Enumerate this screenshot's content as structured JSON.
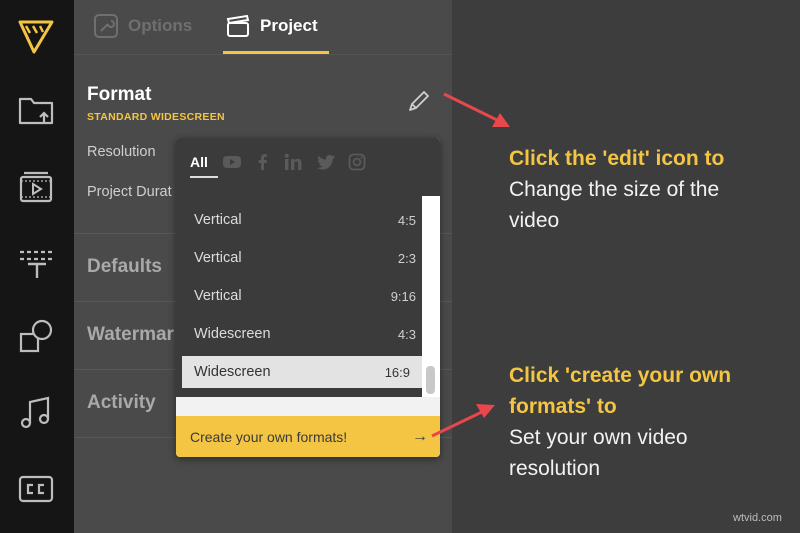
{
  "tabs": [
    {
      "label": "Options",
      "icon": "wrench-icon"
    },
    {
      "label": "Project",
      "icon": "clapperboard-icon"
    }
  ],
  "format": {
    "title": "Format",
    "subtitle": "STANDARD WIDESCREEN",
    "resolution_label": "Resolution",
    "duration_label": "Project Durat"
  },
  "sections": [
    "Defaults",
    "Watermar",
    "Activity"
  ],
  "popup": {
    "tabs": [
      "All",
      "youtube-icon",
      "facebook-icon",
      "linkedin-icon",
      "twitter-icon",
      "instagram-icon"
    ],
    "options": [
      {
        "name": "Vertical",
        "ratio": "4:5"
      },
      {
        "name": "Vertical",
        "ratio": "2:3"
      },
      {
        "name": "Vertical",
        "ratio": "9:16"
      },
      {
        "name": "Widescreen",
        "ratio": "4:3"
      },
      {
        "name": "Widescreen",
        "ratio": "16:9"
      }
    ],
    "selected": "Widescreen 16:9",
    "footer_label": "Create your own formats!",
    "footer_arrow": "→"
  },
  "callouts": [
    {
      "highlight": [
        "Click the 'edit' icon to"
      ],
      "body": [
        "Change the size of the",
        "video"
      ]
    },
    {
      "highlight": [
        "Click 'create your own",
        "formats' to"
      ],
      "body": [
        "Set your own video",
        "resolution"
      ]
    }
  ],
  "watermark": "wtvid.com",
  "colors": {
    "accent": "#f4c542",
    "arrow": "#e8474c",
    "rail": "#151515",
    "panel": "#4a4a4a",
    "background": "#3d3d3d"
  }
}
